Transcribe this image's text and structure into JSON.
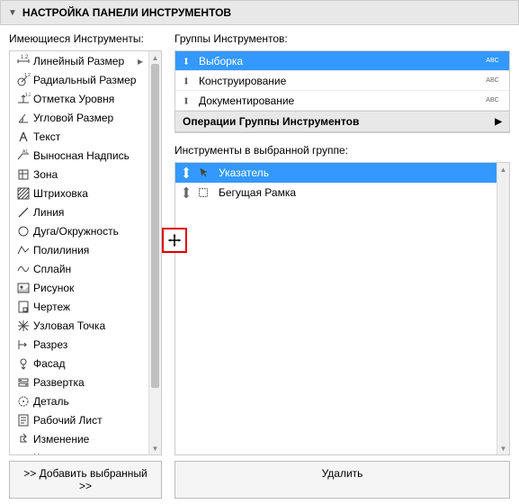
{
  "header": {
    "title": "НАСТРОЙКА ПАНЕЛИ ИНСТРУМЕНТОВ"
  },
  "left": {
    "label": "Имеющиеся Инструменты:",
    "items": [
      {
        "icon": "dim-linear",
        "label": "Линейный Размер",
        "arrow": true
      },
      {
        "icon": "dim-radial",
        "label": "Радиальный Размер"
      },
      {
        "icon": "level",
        "label": "Отметка Уровня"
      },
      {
        "icon": "dim-angular",
        "label": "Угловой Размер"
      },
      {
        "icon": "text",
        "label": "Текст"
      },
      {
        "icon": "leader",
        "label": "Выносная Надпись"
      },
      {
        "icon": "zone",
        "label": "Зона"
      },
      {
        "icon": "hatch",
        "label": "Штриховка"
      },
      {
        "icon": "line",
        "label": "Линия"
      },
      {
        "icon": "arc",
        "label": "Дуга/Окружность"
      },
      {
        "icon": "polyline",
        "label": "Полилиния"
      },
      {
        "icon": "spline",
        "label": "Сплайн"
      },
      {
        "icon": "image",
        "label": "Рисунок"
      },
      {
        "icon": "drawing",
        "label": "Чертеж"
      },
      {
        "icon": "node",
        "label": "Узловая Точка"
      },
      {
        "icon": "section",
        "label": "Разрез"
      },
      {
        "icon": "elevation",
        "label": "Фасад"
      },
      {
        "icon": "unfold",
        "label": "Развертка"
      },
      {
        "icon": "detail",
        "label": "Деталь"
      },
      {
        "icon": "worksheet",
        "label": "Рабочий Лист"
      },
      {
        "icon": "change",
        "label": "Изменение"
      },
      {
        "icon": "camera",
        "label": "Камера"
      }
    ]
  },
  "right": {
    "groups_label": "Группы Инструментов:",
    "groups": [
      {
        "label": "Выборка",
        "selected": true,
        "pin": true
      },
      {
        "label": "Конструирование",
        "selected": false,
        "pin": false
      },
      {
        "label": "Документирование",
        "selected": false,
        "pin": false
      }
    ],
    "ops_label": "Операции Группы Инструментов",
    "tools_label": "Инструменты в выбранной группе:",
    "tools": [
      {
        "icon": "pointer",
        "label": "Указатель",
        "selected": true
      },
      {
        "icon": "marquee",
        "label": "Бегущая Рамка",
        "selected": false
      }
    ]
  },
  "footer": {
    "add": ">> Добавить выбранный >>",
    "delete": "Удалить"
  }
}
